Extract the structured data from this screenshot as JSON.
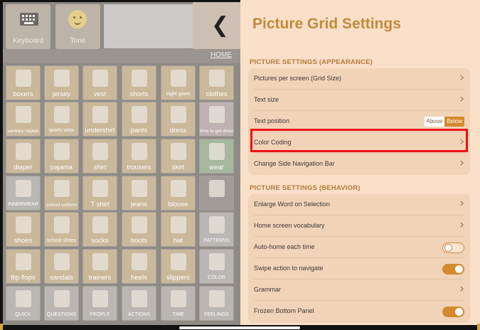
{
  "toolbar": {
    "keyboard_label": "Keyboard",
    "tone_label": "Tone",
    "back_icon": "chevron-left-icon"
  },
  "breadcrumb": {
    "home": "HOME"
  },
  "grid": [
    [
      {
        "label": "boxers",
        "c": "c-cl"
      },
      {
        "label": "jersey",
        "c": "c-cl"
      },
      {
        "label": "vest",
        "c": "c-cl"
      },
      {
        "label": "shorts",
        "c": "c-cl"
      },
      {
        "label": "night gown",
        "c": "c-cl",
        "s": "sm"
      },
      {
        "label": "clothes",
        "c": "c-cl"
      }
    ],
    [
      {
        "label": "sanitary napkin",
        "c": "c-cl",
        "s": "sm2"
      },
      {
        "label": "sports wear",
        "c": "c-cl",
        "s": "sm"
      },
      {
        "label": "undershirt",
        "c": "c-cl"
      },
      {
        "label": "pants",
        "c": "c-cl"
      },
      {
        "label": "dress",
        "c": "c-cl"
      },
      {
        "label": "time to get dressed",
        "c": "c-pi",
        "s": "sm2"
      }
    ],
    [
      {
        "label": "diaper",
        "c": "c-cl"
      },
      {
        "label": "pajama",
        "c": "c-cl"
      },
      {
        "label": "shirt",
        "c": "c-cl"
      },
      {
        "label": "trousers",
        "c": "c-cl"
      },
      {
        "label": "skirt",
        "c": "c-cl"
      },
      {
        "label": "wear",
        "c": "c-gr"
      }
    ],
    [
      {
        "label": "INNERWEAR",
        "c": "c-wh",
        "s": "sm"
      },
      {
        "label": "school uniform",
        "c": "c-cl",
        "s": "sm2"
      },
      {
        "label": "T shirt",
        "c": "c-cl"
      },
      {
        "label": "jeans",
        "c": "c-cl"
      },
      {
        "label": "blouse",
        "c": "c-cl"
      },
      {
        "label": "",
        "c": "c-gy"
      }
    ],
    [
      {
        "label": "shoes",
        "c": "c-cl"
      },
      {
        "label": "school shoes",
        "c": "c-cl",
        "s": "sm"
      },
      {
        "label": "socks",
        "c": "c-cl"
      },
      {
        "label": "boots",
        "c": "c-cl"
      },
      {
        "label": "hat",
        "c": "c-cl"
      },
      {
        "label": "PATTERNS",
        "c": "c-wh",
        "s": "sm"
      }
    ],
    [
      {
        "label": "flip flops",
        "c": "c-cl"
      },
      {
        "label": "sandals",
        "c": "c-cl"
      },
      {
        "label": "trainers",
        "c": "c-cl"
      },
      {
        "label": "heels",
        "c": "c-cl"
      },
      {
        "label": "slippers",
        "c": "c-cl"
      },
      {
        "label": "COLOR",
        "c": "c-wh",
        "s": "sm"
      }
    ],
    [
      {
        "label": "QUICK",
        "c": "c-wh",
        "s": "sm"
      },
      {
        "label": "QUESTIONS",
        "c": "c-wh",
        "s": "sm"
      },
      {
        "label": "PEOPLE",
        "c": "c-wh",
        "s": "sm"
      },
      {
        "label": "ACTIONS",
        "c": "c-wh",
        "s": "sm"
      },
      {
        "label": "TIME",
        "c": "c-wh",
        "s": "sm"
      },
      {
        "label": "FEELINGS",
        "c": "c-wh",
        "s": "sm"
      }
    ]
  ],
  "panel": {
    "title": "Picture Grid Settings",
    "appearance": {
      "title": "PICTURE SETTINGS (APPEARANCE)",
      "rows": [
        {
          "label": "Pictures per screen (Grid Size)",
          "type": "nav"
        },
        {
          "label": "Text size",
          "type": "nav"
        },
        {
          "label": "Text position",
          "type": "seg",
          "options": [
            "Above",
            "Below"
          ],
          "selected": "Below"
        },
        {
          "label": "Color Coding",
          "type": "nav"
        },
        {
          "label": "Change Side Navigation Bar",
          "type": "nav"
        }
      ]
    },
    "behavior": {
      "title": "PICTURE SETTINGS (BEHAVIOR)",
      "rows": [
        {
          "label": "Enlarge Word on Selection",
          "type": "nav"
        },
        {
          "label": "Home screen vocabulary",
          "type": "nav"
        },
        {
          "label": "Auto-home each time",
          "type": "toggle",
          "on": false
        },
        {
          "label": "Swipe action to navigate",
          "type": "toggle",
          "on": true
        },
        {
          "label": "Grammar",
          "type": "nav"
        },
        {
          "label": "Frozen Bottom Panel",
          "type": "toggle",
          "on": true
        }
      ]
    }
  },
  "colors": {
    "accent": "#d38a2e",
    "title": "#c28a3c",
    "panel_bg": "#fae0c8",
    "group_bg": "#f1d3b7",
    "highlight": "#ee1111"
  }
}
